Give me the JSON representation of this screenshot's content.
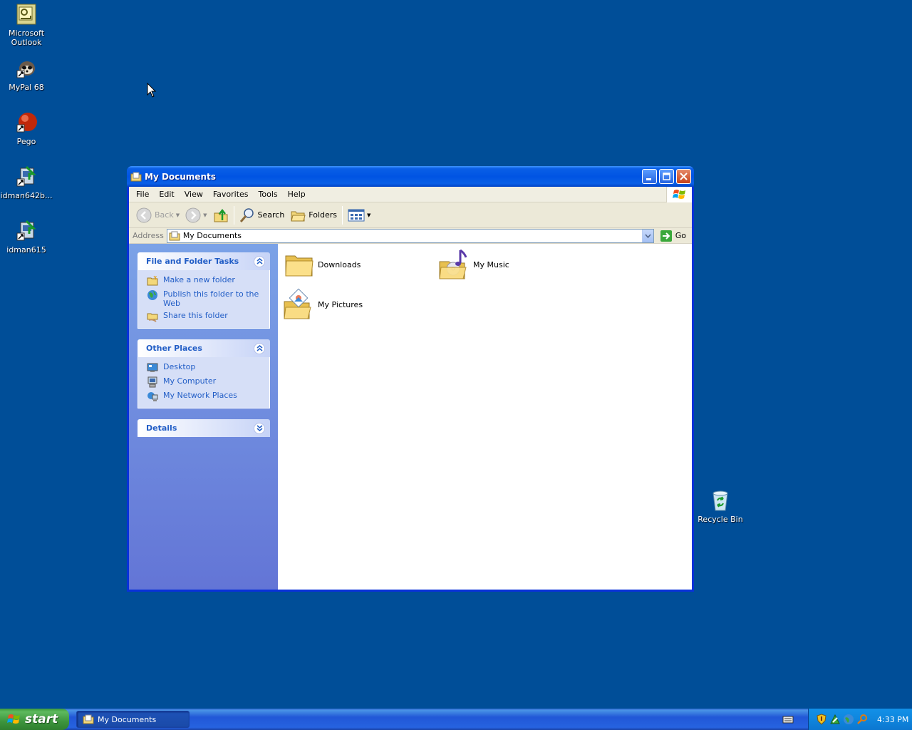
{
  "desktop": {
    "icons": [
      {
        "label": "Microsoft Outlook"
      },
      {
        "label": "MyPal 68"
      },
      {
        "label": "Pego"
      },
      {
        "label": "idman642b..."
      },
      {
        "label": "idman615"
      },
      {
        "label": "Recycle Bin"
      }
    ]
  },
  "window": {
    "title": "My Documents",
    "menu": [
      "File",
      "Edit",
      "View",
      "Favorites",
      "Tools",
      "Help"
    ],
    "toolbar": {
      "back": "Back",
      "search": "Search",
      "folders": "Folders"
    },
    "address": {
      "label": "Address",
      "value": "My Documents",
      "go": "Go"
    },
    "taskpane": {
      "file_tasks": {
        "title": "File and Folder Tasks",
        "items": [
          "Make a new folder",
          "Publish this folder to the Web",
          "Share this folder"
        ]
      },
      "other_places": {
        "title": "Other Places",
        "items": [
          "Desktop",
          "My Computer",
          "My Network Places"
        ]
      },
      "details": {
        "title": "Details"
      }
    },
    "files": [
      {
        "name": "Downloads"
      },
      {
        "name": "My Music"
      },
      {
        "name": "My Pictures"
      }
    ]
  },
  "taskbar": {
    "start": "start",
    "task": "My Documents",
    "clock": "4:33 PM"
  },
  "colors": {
    "desktop": "#004e98",
    "title_bar": "#0054e3",
    "task_link": "#215dc6",
    "start_green": "#3d953d"
  }
}
